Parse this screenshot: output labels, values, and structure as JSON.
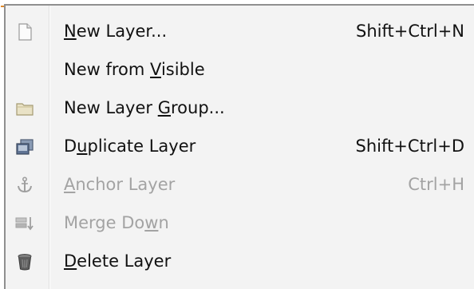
{
  "menu": {
    "items": [
      {
        "icon": "new-layer-icon",
        "label": {
          "before": "",
          "mnemonic": "N",
          "after": "ew Layer..."
        },
        "shortcut": "Shift+Ctrl+N",
        "enabled": true
      },
      {
        "icon": "",
        "label": {
          "before": "New from ",
          "mnemonic": "V",
          "after": "isible"
        },
        "shortcut": "",
        "enabled": true
      },
      {
        "icon": "layer-group-folder-icon",
        "label": {
          "before": "New Layer ",
          "mnemonic": "G",
          "after": "roup..."
        },
        "shortcut": "",
        "enabled": true
      },
      {
        "icon": "duplicate-layer-icon",
        "label": {
          "before": "D",
          "mnemonic": "u",
          "after": "plicate Layer"
        },
        "shortcut": "Shift+Ctrl+D",
        "enabled": true
      },
      {
        "icon": "anchor-icon",
        "label": {
          "before": "",
          "mnemonic": "A",
          "after": "nchor Layer"
        },
        "shortcut": "Ctrl+H",
        "enabled": false
      },
      {
        "icon": "merge-down-icon",
        "label": {
          "before": "Merge Do",
          "mnemonic": "w",
          "after": "n"
        },
        "shortcut": "",
        "enabled": false
      },
      {
        "icon": "trash-icon",
        "label": {
          "before": "",
          "mnemonic": "D",
          "after": "elete Layer"
        },
        "shortcut": "",
        "enabled": true
      }
    ]
  },
  "colors": {
    "menu_background": "#f3f3f3",
    "menu_border": "#8f8f8f",
    "enabled_text": "#111111",
    "disabled_text": "#a3a3a3",
    "pointer_accent": "#e08a2c"
  }
}
